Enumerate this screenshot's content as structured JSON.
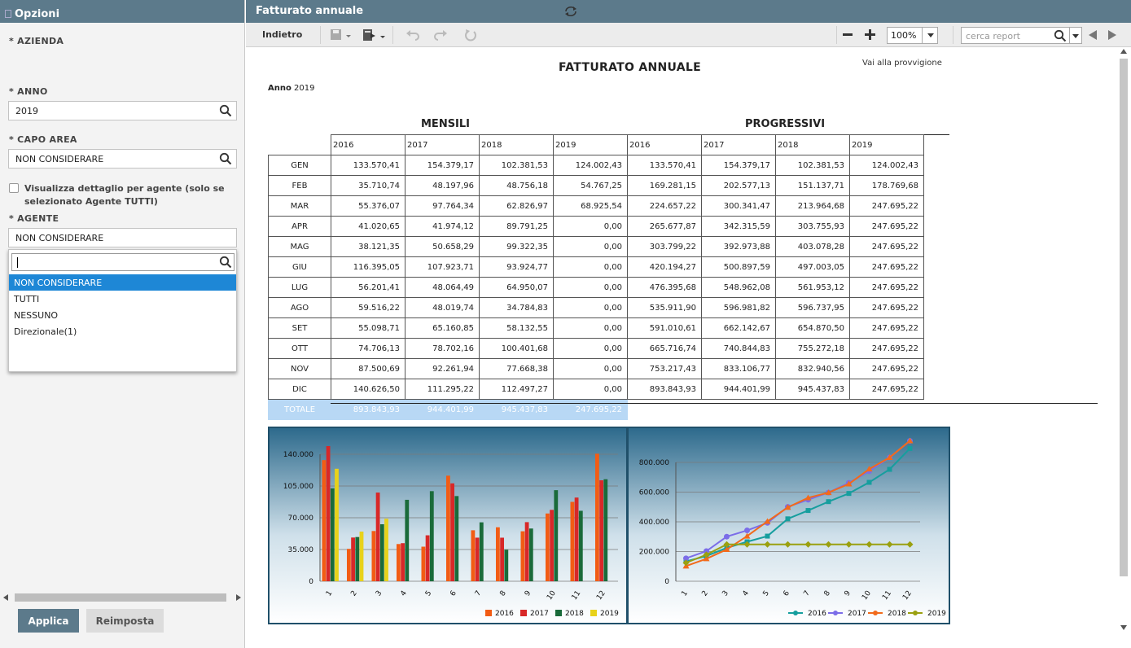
{
  "left_panel": {
    "title": "Opzioni",
    "azienda_label": "* AZIENDA",
    "anno_label": "* ANNO",
    "anno_value": "2019",
    "capo_label": "* CAPO AREA",
    "capo_value": "NON CONSIDERARE",
    "detail_label": "Visualizza dettaglio per agente (solo se selezionato Agente TUTTI)",
    "agente_label": "* AGENTE",
    "agente_value": "NON CONSIDERARE",
    "options": [
      "NON CONSIDERARE",
      "TUTTI",
      "NESSUNO",
      "Direzionale(1)"
    ],
    "apply": "Applica",
    "reset": "Reimposta"
  },
  "report": {
    "header": "Fatturato annuale",
    "back": "Indietro",
    "zoom": "100%",
    "search_placeholder": "cerca report",
    "title": "FATTURATO ANNUALE",
    "link": "Vai alla provvigione",
    "anno_label": "Anno",
    "anno_value": "2019",
    "mensili": "MENSILI",
    "progressivi": "PROGRESSIVI",
    "years": [
      "2016",
      "2017",
      "2018",
      "2019"
    ],
    "months": [
      "GEN",
      "FEB",
      "MAR",
      "APR",
      "MAG",
      "GIU",
      "LUG",
      "AGO",
      "SET",
      "OTT",
      "NOV",
      "DIC"
    ],
    "monthly": [
      [
        "133.570,41",
        "154.379,17",
        "102.381,53",
        "124.002,43"
      ],
      [
        "35.710,74",
        "48.197,96",
        "48.756,18",
        "54.767,25"
      ],
      [
        "55.376,07",
        "97.764,34",
        "62.826,97",
        "68.925,54"
      ],
      [
        "41.020,65",
        "41.974,12",
        "89.791,25",
        "0,00"
      ],
      [
        "38.121,35",
        "50.658,29",
        "99.322,35",
        "0,00"
      ],
      [
        "116.395,05",
        "107.923,71",
        "93.924,77",
        "0,00"
      ],
      [
        "56.201,41",
        "48.064,49",
        "64.950,07",
        "0,00"
      ],
      [
        "59.516,22",
        "48.019,74",
        "34.784,83",
        "0,00"
      ],
      [
        "55.098,71",
        "65.160,85",
        "58.132,55",
        "0,00"
      ],
      [
        "74.706,13",
        "78.702,16",
        "100.401,68",
        "0,00"
      ],
      [
        "87.500,69",
        "92.261,94",
        "77.668,38",
        "0,00"
      ],
      [
        "140.626,50",
        "111.295,22",
        "112.497,27",
        "0,00"
      ]
    ],
    "progressive": [
      [
        "133.570,41",
        "154.379,17",
        "102.381,53",
        "124.002,43"
      ],
      [
        "169.281,15",
        "202.577,13",
        "151.137,71",
        "178.769,68"
      ],
      [
        "224.657,22",
        "300.341,47",
        "213.964,68",
        "247.695,22"
      ],
      [
        "265.677,87",
        "342.315,59",
        "303.755,93",
        "247.695,22"
      ],
      [
        "303.799,22",
        "392.973,88",
        "403.078,28",
        "247.695,22"
      ],
      [
        "420.194,27",
        "500.897,59",
        "497.003,05",
        "247.695,22"
      ],
      [
        "476.395,68",
        "548.962,08",
        "561.953,12",
        "247.695,22"
      ],
      [
        "535.911,90",
        "596.981,82",
        "596.737,95",
        "247.695,22"
      ],
      [
        "591.010,61",
        "662.142,67",
        "654.870,50",
        "247.695,22"
      ],
      [
        "665.716,74",
        "740.844,83",
        "755.272,18",
        "247.695,22"
      ],
      [
        "753.217,43",
        "833.106,77",
        "832.940,56",
        "247.695,22"
      ],
      [
        "893.843,93",
        "944.401,99",
        "945.437,83",
        "247.695,22"
      ]
    ],
    "total_label": "TOTALE",
    "totals": [
      "893.843,93",
      "944.401,99",
      "945.437,83",
      "247.695,22"
    ]
  },
  "chart_data": [
    {
      "type": "bar",
      "categories": [
        "1",
        "2",
        "3",
        "4",
        "5",
        "6",
        "7",
        "8",
        "9",
        "10",
        "11",
        "12"
      ],
      "series": [
        {
          "name": "2016",
          "values": [
            133570.41,
            35710.74,
            55376.07,
            41020.65,
            38121.35,
            116395.05,
            56201.41,
            59516.22,
            55098.71,
            74706.13,
            87500.69,
            140626.5
          ]
        },
        {
          "name": "2017",
          "values": [
            154379.17,
            48197.96,
            97764.34,
            41974.12,
            50658.29,
            107923.71,
            48064.49,
            48019.74,
            65160.85,
            78702.16,
            92261.94,
            111295.22
          ]
        },
        {
          "name": "2018",
          "values": [
            102381.53,
            48756.18,
            62826.97,
            89791.25,
            99322.35,
            93924.77,
            64950.07,
            34784.83,
            58132.55,
            100401.68,
            77668.38,
            112497.27
          ]
        },
        {
          "name": "2019",
          "values": [
            124002.43,
            54767.25,
            68925.54,
            0,
            0,
            0,
            0,
            0,
            0,
            0,
            0,
            0
          ]
        }
      ],
      "colors": [
        "#f25c14",
        "#d82828",
        "#1a6b3a",
        "#e8d21a"
      ],
      "ylim": [
        0,
        140000
      ],
      "yticks": [
        "0",
        "35.000",
        "70.000",
        "105.000",
        "140.000"
      ],
      "legend": "bottom-right",
      "grid": true
    },
    {
      "type": "line",
      "categories": [
        "1",
        "2",
        "3",
        "4",
        "5",
        "6",
        "7",
        "8",
        "9",
        "10",
        "11",
        "12"
      ],
      "series": [
        {
          "name": "2016",
          "values": [
            133570.41,
            169281.15,
            224657.22,
            265677.87,
            303799.22,
            420194.27,
            476395.68,
            535911.9,
            591010.61,
            665716.74,
            753217.43,
            893843.93
          ]
        },
        {
          "name": "2017",
          "values": [
            154379.17,
            202577.13,
            300341.47,
            342315.59,
            392973.88,
            500897.59,
            548962.08,
            596981.82,
            662142.67,
            740844.83,
            833106.77,
            944401.99
          ]
        },
        {
          "name": "2018",
          "values": [
            102381.53,
            151137.71,
            213964.68,
            303755.93,
            403078.28,
            497003.05,
            561953.12,
            596737.95,
            654870.5,
            755272.18,
            832940.56,
            945437.83
          ]
        },
        {
          "name": "2019",
          "values": [
            124002.43,
            178769.68,
            247695.22,
            247695.22,
            247695.22,
            247695.22,
            247695.22,
            247695.22,
            247695.22,
            247695.22,
            247695.22,
            247695.22
          ]
        }
      ],
      "colors": [
        "#169e9e",
        "#7b6de8",
        "#f26a1b",
        "#9aa010"
      ],
      "ylim": [
        0,
        800000
      ],
      "yticks": [
        "0",
        "200.000",
        "400.000",
        "600.000",
        "800.000"
      ],
      "legend": "bottom-right",
      "grid": true
    }
  ]
}
